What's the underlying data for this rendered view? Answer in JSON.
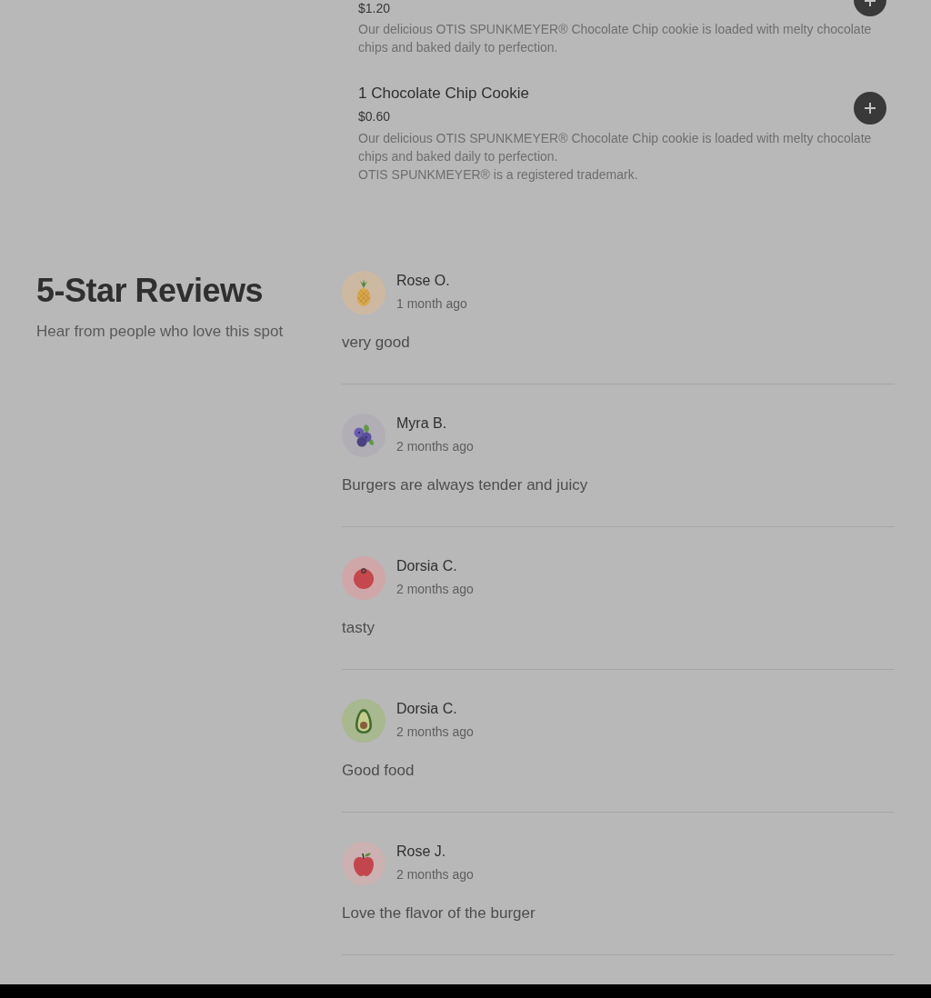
{
  "menu_items": [
    {
      "kind": "partial",
      "price": "$1.20",
      "description": "Our delicious OTIS SPUNKMEYER® Chocolate Chip cookie is loaded with melty chocolate chips and baked daily to perfection."
    },
    {
      "kind": "whole",
      "title": "1 Chocolate Chip Cookie",
      "price": "$0.60",
      "description": "Our delicious OTIS SPUNKMEYER® Chocolate Chip cookie is loaded with melty chocolate chips and baked daily to perfection.",
      "note": "OTIS SPUNKMEYER® is a registered trademark."
    }
  ],
  "reviews_section": {
    "title": "5-Star Reviews",
    "subtitle": "Hear from people who love this spot"
  },
  "reviews": [
    {
      "avatar": {
        "kind": "pineapple"
      },
      "name": "Rose O.",
      "time": "1 month ago",
      "text": "very good"
    },
    {
      "avatar": {
        "kind": "blueberries"
      },
      "name": "Myra B.",
      "time": "2 months ago",
      "text": "Burgers are always tender and juicy"
    },
    {
      "avatar": {
        "kind": "tomato"
      },
      "name": "Dorsia C.",
      "time": "2 months ago",
      "text": "tasty"
    },
    {
      "avatar": {
        "kind": "avocado"
      },
      "name": "Dorsia C.",
      "time": "2 months ago",
      "text": "Good food"
    },
    {
      "avatar": {
        "kind": "apple"
      },
      "name": "Rose J.",
      "time": "2 months ago",
      "text": "Love the flavor of the burger"
    }
  ]
}
